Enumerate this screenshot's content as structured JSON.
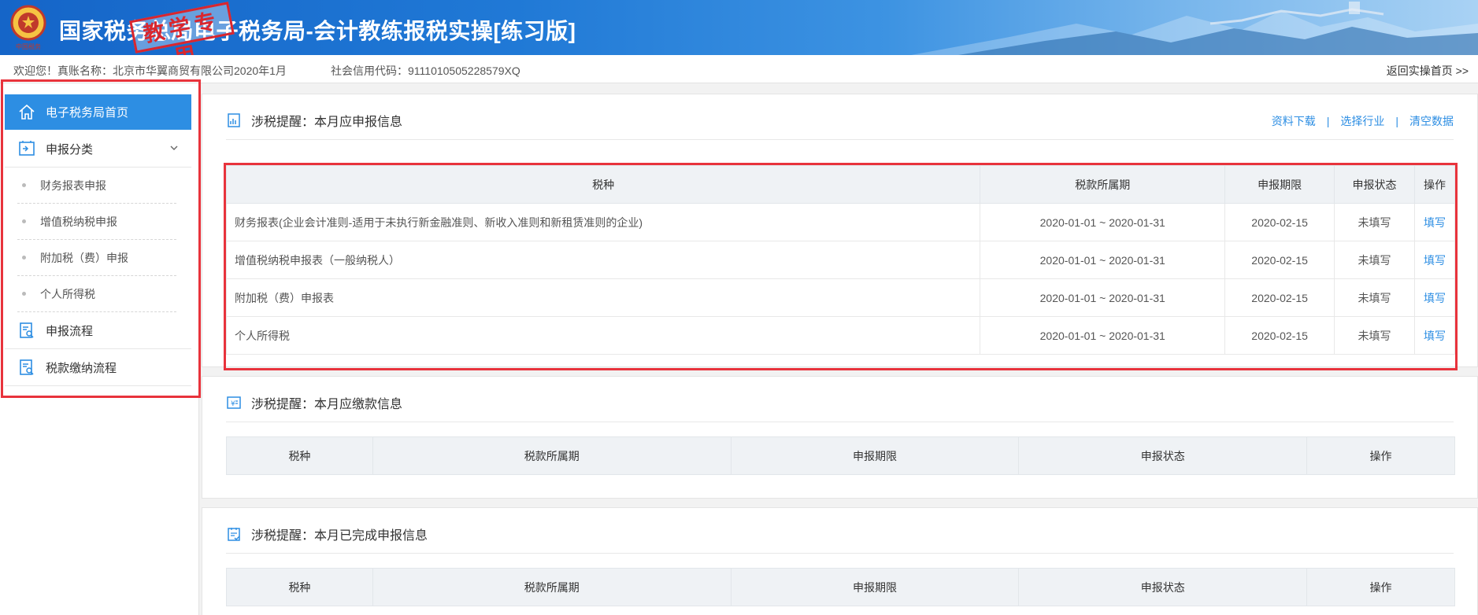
{
  "header": {
    "title": "国家税务总局电子税务局-会计教练报税实操[练习版]",
    "stamp": "教学专用",
    "emblem_text": "中国税务"
  },
  "infobar": {
    "welcome": "欢迎您！真账名称：北京市华翼商贸有限公司2020年1月",
    "credit_code": "社会信用代码：9111010505228579XQ",
    "back_link": "返回实操首页 >>"
  },
  "sidebar": {
    "home": "电子税务局首页",
    "category": "申报分类",
    "sub_items": [
      "财务报表申报",
      "增值税纳税申报",
      "附加税（费）申报",
      "个人所得税"
    ],
    "process": "申报流程",
    "payment_process": "税款缴纳流程"
  },
  "panel1": {
    "title": "涉税提醒：本月应申报信息",
    "links": [
      "资料下载",
      "选择行业",
      "清空数据"
    ],
    "columns": [
      "税种",
      "税款所属期",
      "申报期限",
      "申报状态",
      "操作"
    ],
    "rows": [
      {
        "name": "财务报表(企业会计准则-适用于未执行新金融准则、新收入准则和新租赁准则的企业)",
        "period": "2020-01-01 ~ 2020-01-31",
        "deadline": "2020-02-15",
        "status": "未填写",
        "action": "填写"
      },
      {
        "name": "增值税纳税申报表（一般纳税人）",
        "period": "2020-01-01 ~ 2020-01-31",
        "deadline": "2020-02-15",
        "status": "未填写",
        "action": "填写"
      },
      {
        "name": "附加税（费）申报表",
        "period": "2020-01-01 ~ 2020-01-31",
        "deadline": "2020-02-15",
        "status": "未填写",
        "action": "填写"
      },
      {
        "name": "个人所得税",
        "period": "2020-01-01 ~ 2020-01-31",
        "deadline": "2020-02-15",
        "status": "未填写",
        "action": "填写"
      }
    ]
  },
  "panel2": {
    "title": "涉税提醒：本月应缴款信息",
    "columns": [
      "税种",
      "税款所属期",
      "申报期限",
      "申报状态",
      "操作"
    ]
  },
  "panel3": {
    "title": "涉税提醒：本月已完成申报信息",
    "columns": [
      "税种",
      "税款所属期",
      "申报期限",
      "申报状态",
      "操作"
    ]
  },
  "colors": {
    "accent": "#2d8ee3",
    "highlight": "#e8333c",
    "stamp": "#d9262e"
  }
}
